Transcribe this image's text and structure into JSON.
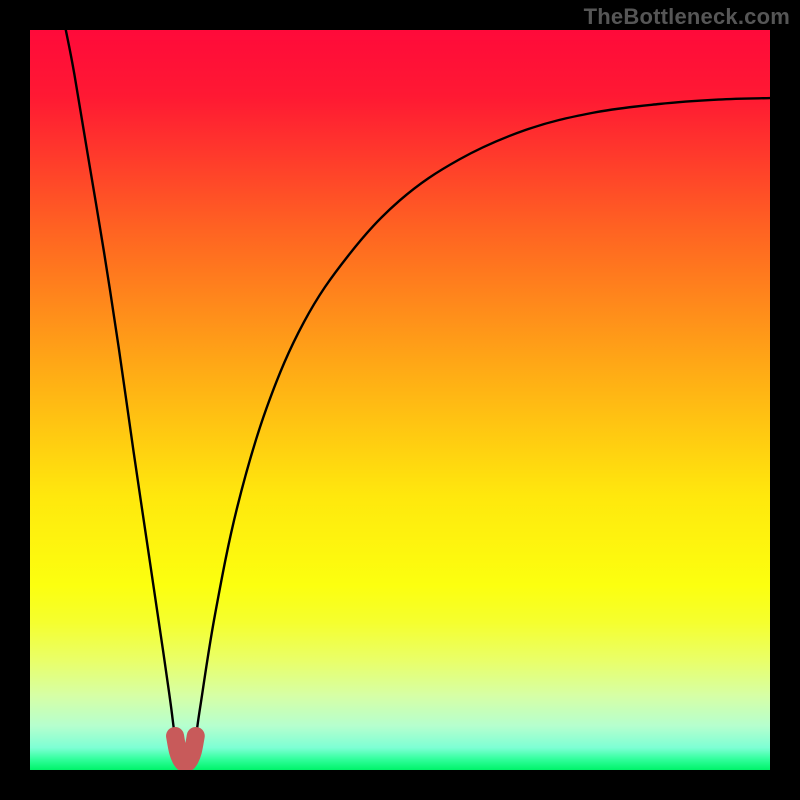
{
  "watermark": "TheBottleneck.com",
  "chart_data": {
    "type": "line",
    "title": "",
    "xlabel": "",
    "ylabel": "",
    "xlim": [
      0,
      1
    ],
    "ylim": [
      0,
      1
    ],
    "x_optimum": 0.21,
    "gradient_stops": [
      {
        "offset": 0.0,
        "color": "#ff0a3a"
      },
      {
        "offset": 0.09,
        "color": "#ff1933"
      },
      {
        "offset": 0.27,
        "color": "#ff6322"
      },
      {
        "offset": 0.45,
        "color": "#ffa716"
      },
      {
        "offset": 0.63,
        "color": "#ffe80d"
      },
      {
        "offset": 0.75,
        "color": "#fcff0f"
      },
      {
        "offset": 0.8,
        "color": "#f5ff2e"
      },
      {
        "offset": 0.85,
        "color": "#eaff66"
      },
      {
        "offset": 0.9,
        "color": "#d6ffa6"
      },
      {
        "offset": 0.94,
        "color": "#b6ffce"
      },
      {
        "offset": 0.97,
        "color": "#7dffd4"
      },
      {
        "offset": 0.985,
        "color": "#33ff9e"
      },
      {
        "offset": 1.0,
        "color": "#00f36a"
      }
    ],
    "series": [
      {
        "name": "bottleneck-curve",
        "points": [
          {
            "x": 0.0484,
            "y": 1.0
          },
          {
            "x": 0.06,
            "y": 0.94
          },
          {
            "x": 0.08,
            "y": 0.82
          },
          {
            "x": 0.1,
            "y": 0.7
          },
          {
            "x": 0.12,
            "y": 0.57
          },
          {
            "x": 0.14,
            "y": 0.43
          },
          {
            "x": 0.16,
            "y": 0.295
          },
          {
            "x": 0.18,
            "y": 0.16
          },
          {
            "x": 0.19,
            "y": 0.09
          },
          {
            "x": 0.196,
            "y": 0.045
          },
          {
            "x": 0.203,
            "y": 0.015
          },
          {
            "x": 0.21,
            "y": 0.008
          },
          {
            "x": 0.217,
            "y": 0.015
          },
          {
            "x": 0.224,
            "y": 0.045
          },
          {
            "x": 0.23,
            "y": 0.085
          },
          {
            "x": 0.25,
            "y": 0.21
          },
          {
            "x": 0.28,
            "y": 0.355
          },
          {
            "x": 0.32,
            "y": 0.49
          },
          {
            "x": 0.37,
            "y": 0.605
          },
          {
            "x": 0.43,
            "y": 0.695
          },
          {
            "x": 0.5,
            "y": 0.77
          },
          {
            "x": 0.58,
            "y": 0.825
          },
          {
            "x": 0.67,
            "y": 0.865
          },
          {
            "x": 0.76,
            "y": 0.888
          },
          {
            "x": 0.85,
            "y": 0.9
          },
          {
            "x": 0.93,
            "y": 0.906
          },
          {
            "x": 1.0,
            "y": 0.908
          }
        ]
      }
    ],
    "marker": {
      "name": "optimum-marker",
      "color": "#c85a5a",
      "points": [
        {
          "x": 0.196,
          "y": 0.046
        },
        {
          "x": 0.2,
          "y": 0.025
        },
        {
          "x": 0.205,
          "y": 0.013
        },
        {
          "x": 0.21,
          "y": 0.009
        },
        {
          "x": 0.215,
          "y": 0.013
        },
        {
          "x": 0.22,
          "y": 0.025
        },
        {
          "x": 0.224,
          "y": 0.046
        }
      ]
    }
  }
}
